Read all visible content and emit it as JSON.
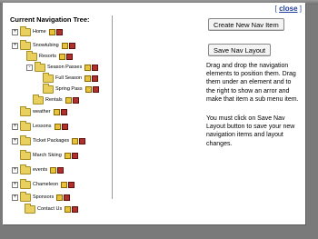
{
  "dialog": {
    "close_label": "close"
  },
  "tree": {
    "title": "Current Navigation Tree:",
    "items": [
      {
        "label": "Home",
        "toggle": "+"
      },
      {
        "label": "Snowtubing",
        "toggle": "+"
      },
      {
        "label": "Resorts",
        "toggle": ""
      },
      {
        "label": "Season Passes",
        "toggle": "-"
      },
      {
        "label": "Full Season",
        "toggle": ""
      },
      {
        "label": "Spring Pass",
        "toggle": ""
      },
      {
        "label": "Rentals",
        "toggle": ""
      },
      {
        "label": "weather",
        "toggle": ""
      },
      {
        "label": "Lessons",
        "toggle": "+"
      },
      {
        "label": "Ticket Packages",
        "toggle": "+"
      },
      {
        "label": "March Skiing",
        "toggle": ""
      },
      {
        "label": "events",
        "toggle": "+"
      },
      {
        "label": "Chameleon",
        "toggle": "+"
      },
      {
        "label": "Sponsors",
        "toggle": "+"
      },
      {
        "label": "Contact Us",
        "toggle": ""
      }
    ]
  },
  "actions": {
    "create_label": "Create New Nav Item",
    "save_label": "Save Nav Layout"
  },
  "help": {
    "drag_text": "Drag and drop the navigation elements to position them. Drag them under an element and to the right to show an arror and make that item a sub menu item.",
    "save_text": "You must click on Save Nav Layout button to save your new navigation items and layout changes."
  }
}
